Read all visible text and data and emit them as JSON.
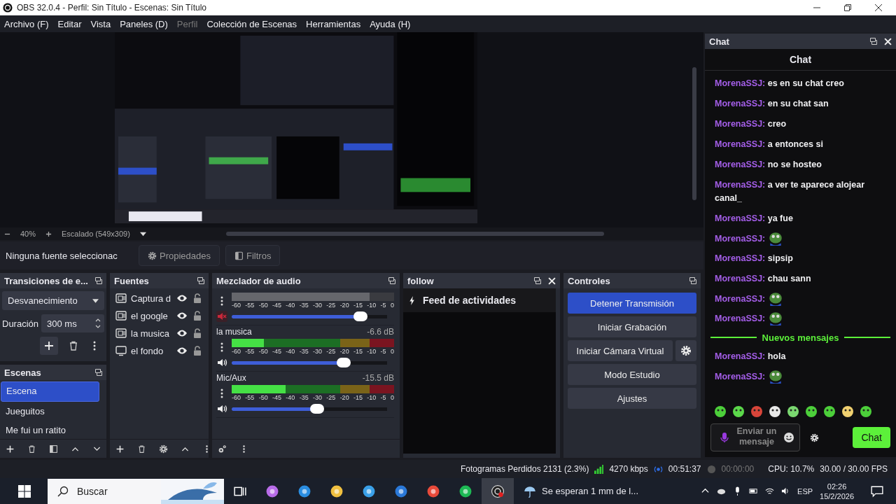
{
  "window": {
    "title": "OBS 32.0.4 - Perfil: Sin Título - Escenas: Sin Título"
  },
  "menu": [
    {
      "label": "Archivo (F)",
      "disabled": false
    },
    {
      "label": "Editar",
      "disabled": false
    },
    {
      "label": "Vista",
      "disabled": false
    },
    {
      "label": "Paneles (D)",
      "disabled": false
    },
    {
      "label": "Perfil",
      "disabled": true
    },
    {
      "label": "Colección de Escenas",
      "disabled": false
    },
    {
      "label": "Herramientas",
      "disabled": false
    },
    {
      "label": "Ayuda (H)",
      "disabled": false
    }
  ],
  "preview": {
    "kind": "picture",
    "zoom": "40%",
    "scale": "Escalado (549x309)"
  },
  "source_bar": {
    "label": "Ninguna fuente seleccionac",
    "buttons": [
      {
        "label": "Propiedades"
      },
      {
        "label": "Filtros"
      }
    ]
  },
  "transitions": {
    "title": "Transiciones de e...",
    "transition": "Desvanecimiento",
    "duration_label": "Duración",
    "duration": "300 ms"
  },
  "scenes": {
    "title": "Escenas",
    "items": [
      {
        "label": "Escena",
        "selected": true
      },
      {
        "label": "Jueguitos",
        "selected": false
      },
      {
        "label": "Me fui un ratito",
        "selected": false
      }
    ]
  },
  "sources": {
    "title": "Fuentes",
    "items": [
      {
        "label": "Captura d",
        "kind": "window"
      },
      {
        "label": "el google",
        "kind": "window"
      },
      {
        "label": "la musica",
        "kind": "window"
      },
      {
        "label": "el fondo",
        "kind": "monitor"
      }
    ]
  },
  "mixer": {
    "title": "Mezclador de audio",
    "channels": [
      {
        "muted": true,
        "meter": {
          "level": 0.85
        },
        "volume": {
          "level": 0.83
        },
        "scale": [
          "-60",
          "-55",
          "-50",
          "-45",
          "-40",
          "-35",
          "-30",
          "-25",
          "-20",
          "-15",
          "-10",
          "-5",
          "0"
        ]
      },
      {
        "name": "la musica",
        "reading": "-6.6 dB",
        "muted": false,
        "meter": {
          "level": 0.2
        },
        "volume": {
          "level": 0.72
        },
        "scale": [
          "-60",
          "-55",
          "-50",
          "-45",
          "-40",
          "-35",
          "-30",
          "-25",
          "-20",
          "-15",
          "-10",
          "-5",
          "0"
        ]
      },
      {
        "name": "Mic/Aux",
        "reading": "-15.5 dB",
        "muted": false,
        "meter": {
          "level": 0.33
        },
        "volume": {
          "level": 0.55
        },
        "scale": [
          "-60",
          "-55",
          "-50",
          "-45",
          "-40",
          "-35",
          "-30",
          "-25",
          "-20",
          "-15",
          "-10",
          "-5",
          "0"
        ]
      }
    ]
  },
  "follow": {
    "title": "follow",
    "feed": "Feed de actividades"
  },
  "controls": {
    "title": "Controles",
    "buttons": [
      {
        "label": "Detener Transmisión",
        "active": true,
        "settings": false
      },
      {
        "label": "Iniciar Grabación",
        "active": false,
        "settings": false
      },
      {
        "label": "Iniciar Cámara Virtual",
        "active": false,
        "settings": true
      },
      {
        "label": "Modo Estudio",
        "active": false,
        "settings": false
      },
      {
        "label": "Ajustes",
        "active": false,
        "settings": false
      }
    ]
  },
  "chat": {
    "title": "Chat",
    "header": "Chat",
    "messages": [
      {
        "kind": "text",
        "user": "MorenaSSJ:",
        "text": "es en su chat creo"
      },
      {
        "kind": "text",
        "user": "MorenaSSJ:",
        "text": "en su chat san"
      },
      {
        "kind": "text",
        "user": "MorenaSSJ:",
        "text": "creo"
      },
      {
        "kind": "text",
        "user": "MorenaSSJ:",
        "text": "a entonces si"
      },
      {
        "kind": "text",
        "user": "MorenaSSJ:",
        "text": "no se hosteo"
      },
      {
        "kind": "text",
        "user": "MorenaSSJ:",
        "text": "a ver te aparece alojear canal_"
      },
      {
        "kind": "text",
        "user": "MorenaSSJ:",
        "text": "ya fue"
      },
      {
        "kind": "emote",
        "user": "MorenaSSJ:"
      },
      {
        "kind": "text",
        "user": "MorenaSSJ:",
        "text": "sipsip"
      },
      {
        "kind": "text",
        "user": "MorenaSSJ:",
        "text": "chau sann"
      },
      {
        "kind": "emote",
        "user": "MorenaSSJ:"
      },
      {
        "kind": "emote",
        "user": "MorenaSSJ:"
      },
      {
        "kind": "divider",
        "text": "Nuevos mensajes"
      },
      {
        "kind": "text",
        "user": "MorenaSSJ:",
        "text": "hola"
      },
      {
        "kind": "emote",
        "user": "MorenaSSJ:"
      }
    ],
    "placeholder": "Enviar un mensaje",
    "send": "Chat"
  },
  "status": {
    "dropped": "Fotogramas Perdidos 2131 (2.3%)",
    "bitrate": "4270 kbps",
    "stream_time": "00:51:37",
    "rec_time": "00:00:00",
    "cpu": "CPU: 10.7%",
    "fps": "30.00 / 30.00 FPS"
  },
  "taskbar": {
    "search": "Buscar",
    "weather": "Se esperan 1 mm de l...",
    "lang": "ESP",
    "time": "02:26",
    "date": "15/2/2026"
  }
}
